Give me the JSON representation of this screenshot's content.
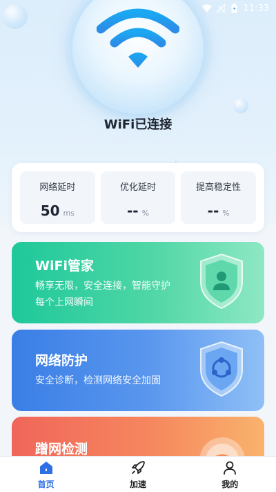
{
  "status_bar": {
    "time": "11:33",
    "icons": [
      "wifi-icon",
      "signal-off-icon",
      "battery-icon"
    ]
  },
  "hero": {
    "title": "WiFi已连接",
    "icon": "wifi-icon"
  },
  "stats": [
    {
      "label": "网络延时",
      "value": "50",
      "unit": "ms"
    },
    {
      "label": "优化延时",
      "value": "--",
      "unit": "%"
    },
    {
      "label": "提高稳定性",
      "value": "--",
      "unit": "%"
    }
  ],
  "features": [
    {
      "title": "WiFi管家",
      "desc": "畅享无限，安全连接，智能守护每个上网瞬间",
      "icon": "user-shield-icon"
    },
    {
      "title": "网络防护",
      "desc": "安全诊断，检测网络安全加固",
      "icon": "network-shield-icon"
    },
    {
      "title": "蹭网检测",
      "desc": "",
      "icon": "wifi-scan-icon"
    }
  ],
  "tabbar": [
    {
      "label": "首页",
      "icon": "home-icon",
      "active": true
    },
    {
      "label": "加速",
      "icon": "rocket-icon",
      "active": false
    },
    {
      "label": "我的",
      "icon": "profile-icon",
      "active": false
    }
  ],
  "colors": {
    "accent": "#2f6fe6",
    "green_card": "#1ec89a",
    "blue_card": "#3a7ee6",
    "orange_card": "#f0665a"
  }
}
